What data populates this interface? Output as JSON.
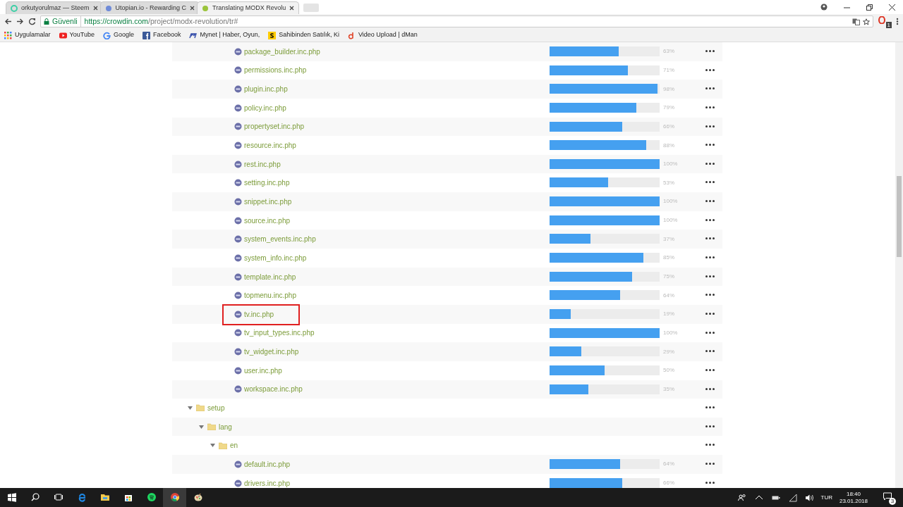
{
  "browser": {
    "tabs": [
      {
        "title": "orkutyorulmaz — Steem",
        "selected": false
      },
      {
        "title": "Utopian.io - Rewarding C",
        "selected": false
      },
      {
        "title": "Translating MODX Revolu",
        "selected": true
      }
    ],
    "security_label": "Güvenli",
    "url_host": "https://crowdin.com",
    "url_path": "/project/modx-revolution/tr#",
    "bookmarks": [
      "Uygulamalar",
      "YouTube",
      "Google",
      "Facebook",
      "Mynet | Haber, Oyun,",
      "Sahibinden Satılık, Ki",
      "Video Upload | dMan"
    ],
    "extension_badge": "1"
  },
  "tree": {
    "continued_files": [
      {
        "name": "package_builder.inc.php",
        "level": 0.63,
        "reading": "63%",
        "highlighted": false
      },
      {
        "name": "permissions.inc.php",
        "level": 0.71,
        "reading": "71%",
        "highlighted": false
      },
      {
        "name": "plugin.inc.php",
        "level": 0.98,
        "reading": "98%",
        "highlighted": false
      },
      {
        "name": "policy.inc.php",
        "level": 0.79,
        "reading": "79%",
        "highlighted": false
      },
      {
        "name": "propertyset.inc.php",
        "level": 0.66,
        "reading": "66%",
        "highlighted": false
      },
      {
        "name": "resource.inc.php",
        "level": 0.88,
        "reading": "88%",
        "highlighted": false
      },
      {
        "name": "rest.inc.php",
        "level": 1,
        "reading": "100%",
        "highlighted": false
      },
      {
        "name": "setting.inc.php",
        "level": 0.53,
        "reading": "53%",
        "highlighted": false
      },
      {
        "name": "snippet.inc.php",
        "level": 1,
        "reading": "100%",
        "highlighted": false
      },
      {
        "name": "source.inc.php",
        "level": 1,
        "reading": "100%",
        "highlighted": false
      },
      {
        "name": "system_events.inc.php",
        "level": 0.37,
        "reading": "37%",
        "highlighted": false
      },
      {
        "name": "system_info.inc.php",
        "level": 0.85,
        "reading": "85%",
        "highlighted": false
      },
      {
        "name": "template.inc.php",
        "level": 0.75,
        "reading": "75%",
        "highlighted": false
      },
      {
        "name": "topmenu.inc.php",
        "level": 0.64,
        "reading": "64%",
        "highlighted": false
      },
      {
        "name": "tv.inc.php",
        "level": 0.19,
        "reading": "19%",
        "highlighted": true
      },
      {
        "name": "tv_input_types.inc.php",
        "level": 1,
        "reading": "100%",
        "highlighted": false
      },
      {
        "name": "tv_widget.inc.php",
        "level": 0.29,
        "reading": "29%",
        "highlighted": false
      },
      {
        "name": "user.inc.php",
        "level": 0.5,
        "reading": "50%",
        "highlighted": false
      },
      {
        "name": "workspace.inc.php",
        "level": 0.35,
        "reading": "35%",
        "highlighted": false
      }
    ],
    "folders": [
      {
        "name": "setup",
        "expanded": true,
        "children": [
          {
            "name": "lang",
            "expanded": true,
            "children": [
              {
                "name": "en",
                "expanded": true,
                "files": [
                  {
                    "name": "default.inc.php",
                    "level": 0.64,
                    "reading": "64%",
                    "highlighted": false
                  },
                  {
                    "name": "drivers.inc.php",
                    "level": 0.66,
                    "reading": "66%",
                    "highlighted": false
                  }
                ]
              }
            ]
          }
        ]
      }
    ]
  },
  "taskbar": {
    "language": "TUR",
    "time": "18:40",
    "date": "23.01.2018",
    "notification_count": "3"
  }
}
